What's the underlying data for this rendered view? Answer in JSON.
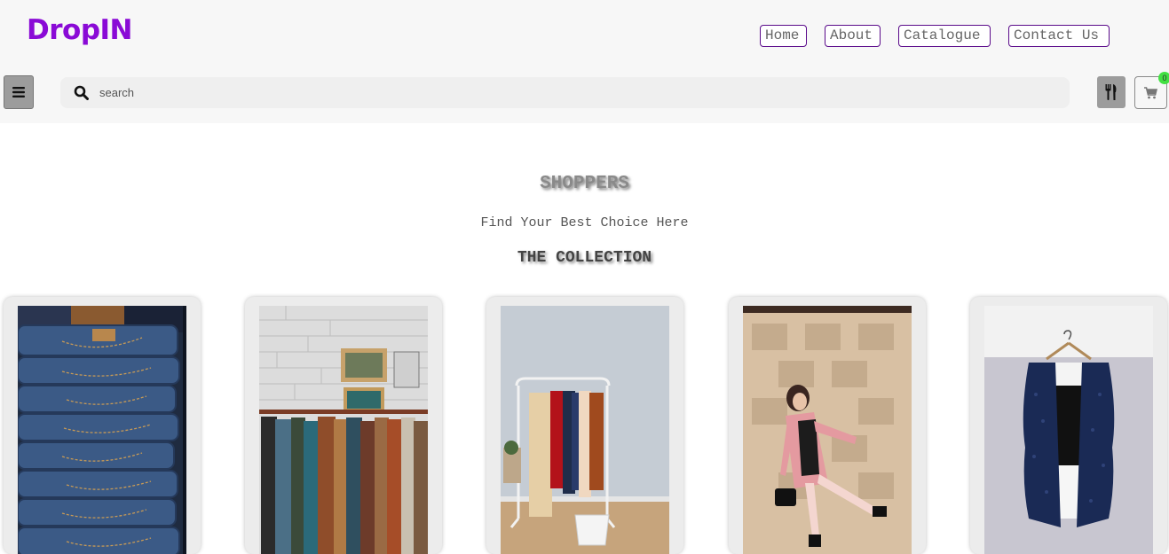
{
  "brand": {
    "name": "DropIN",
    "color": "#8a0ad6"
  },
  "nav": {
    "items": [
      {
        "label": "Home"
      },
      {
        "label": "About"
      },
      {
        "label": "Catalogue"
      },
      {
        "label": "Contact Us"
      }
    ]
  },
  "toolbar": {
    "menu_icon": "hamburger-menu-icon",
    "search_icon": "search-icon",
    "search_placeholder": "search",
    "search_value": "",
    "tool_icon": "utensils-icon",
    "cart_icon": "shopping-cart-icon",
    "cart_count": "0",
    "cart_badge_color": "#43e043"
  },
  "hero": {
    "title": "SHOPPERS",
    "subtitle": "Find Your Best Choice Here",
    "section_title": "THE COLLECTION"
  },
  "products": [
    {
      "image": "stack-of-folded-jeans"
    },
    {
      "image": "clothing-rack-against-brick-wall"
    },
    {
      "image": "white-garment-rack-with-coats"
    },
    {
      "image": "woman-in-pink-coat"
    },
    {
      "image": "navy-crochet-vest-on-hanger"
    }
  ]
}
